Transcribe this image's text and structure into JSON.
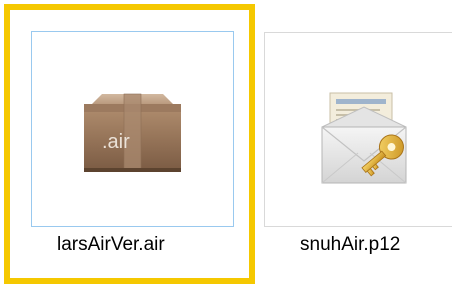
{
  "files": [
    {
      "name": "larsAirVer.air",
      "icon_text": ".air",
      "icon": "package-box-icon",
      "selected": true
    },
    {
      "name": "snuhAir.p12",
      "icon": "certificate-envelope-key-icon",
      "selected": false
    }
  ],
  "colors": {
    "highlight": "#f5c800",
    "selection_border": "#99c9ef",
    "thumb_border": "#d9d9d9"
  }
}
